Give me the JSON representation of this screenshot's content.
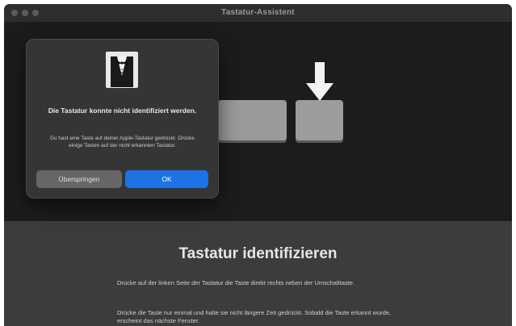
{
  "window": {
    "title": "Tastatur-Assistent"
  },
  "stage": {
    "arrow_icon": "down-arrow-icon"
  },
  "info": {
    "title": "Tastatur identifizieren",
    "paragraph1": "Drücke auf der linken Seite der Tastatur die Taste direkt rechts neben der Umschalttaste.",
    "paragraph2": "Drücke die Taste nur einmal und halte sie nicht längere Zeit gedrückt. Sobald die Taste erkannt wurde, erscheint das nächste Fenster."
  },
  "dialog": {
    "icon": "tuxedo-icon",
    "title": "Die Tastatur konnte nicht identifiziert werden.",
    "message": "Du hast eine Taste auf deiner Apple-Tastatur gedrückt. Drücke einige Tasten auf der nicht erkannten Tastatur.",
    "skip_label": "Überspringen",
    "ok_label": "OK"
  },
  "colors": {
    "accent": "#1d72e6",
    "dialog_bg": "#353535",
    "window_bg": "#232323"
  }
}
